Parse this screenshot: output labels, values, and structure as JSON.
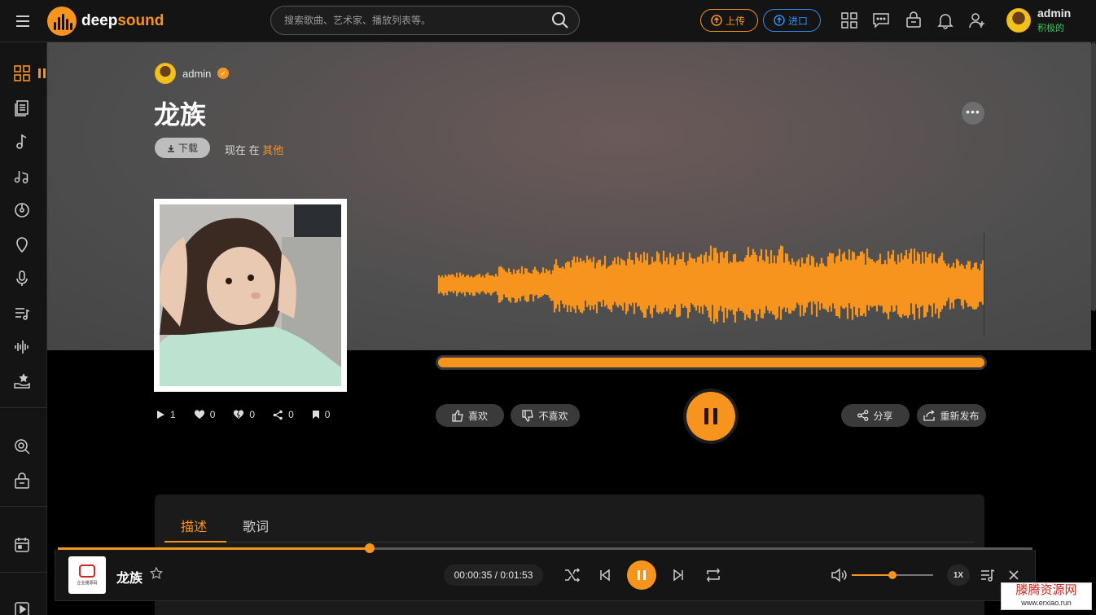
{
  "header": {
    "logo_text_a": "deep",
    "logo_text_b": "sound",
    "search_placeholder": "搜索歌曲、艺术家、播放列表等。",
    "upload_label": "上传",
    "import_label": "进口",
    "user_name": "admin",
    "user_status": "积极的"
  },
  "song": {
    "artist": "admin",
    "title": "龙族",
    "download_label": "下载",
    "now_in_prefix": "现在 在",
    "genre": "其他",
    "more_label": "•••",
    "plays": "1",
    "likes": "0",
    "dislikes": "0",
    "shares": "0",
    "saves": "0",
    "like_label": "喜欢",
    "dislike_label": "不喜欢",
    "share_label": "分享",
    "repost_label": "重新发布",
    "progress": 1.0
  },
  "tabs": [
    {
      "label": "描述"
    },
    {
      "label": "歌词"
    }
  ],
  "player": {
    "title": "龙族",
    "time": "00:00:35 / 0:01:53",
    "speed": "1X",
    "seek_fraction": 0.32,
    "volume_fraction": 0.5,
    "cover_brand": "企业猫源码"
  },
  "watermark": {
    "line1": "滕腾资源网",
    "line2": "www.erxiao.run"
  },
  "colors": {
    "accent": "#f7941d",
    "import_blue": "#2f8fe8",
    "online_green": "#30d159"
  }
}
